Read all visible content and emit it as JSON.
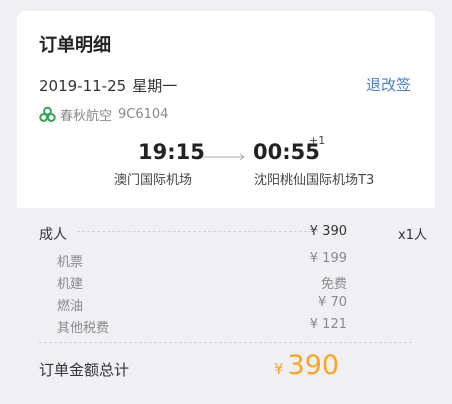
{
  "order": {
    "title": "订单明细",
    "date": "2019-11-25",
    "weekday": "星期一",
    "change_label": "退改签"
  },
  "airline": {
    "name": "春秋航空",
    "flight_no": "9C6104",
    "logo_icon": "spring-airlines-logo-icon",
    "logo_color": "#3aa35a"
  },
  "route": {
    "departure_time": "19:15",
    "departure_airport": "澳门国际机场",
    "arrival_time": "00:55",
    "day_offset": "+1",
    "arrival_airport": "沈阳桃仙国际机场T3",
    "arrow_icon": "arrow-right-icon"
  },
  "price": {
    "adult": {
      "label": "成人",
      "amount": "¥ 390",
      "qty": "x1人"
    },
    "items": [
      {
        "label": "机票",
        "amount": "¥ 199"
      },
      {
        "label": "机建",
        "amount": "免费"
      },
      {
        "label": "燃油",
        "amount": "¥ 70"
      },
      {
        "label": "其他税费",
        "amount": "¥ 121"
      }
    ],
    "total": {
      "label": "订单金额总计",
      "currency": "¥",
      "value": "390"
    }
  },
  "colors": {
    "accent": "#f5a623",
    "link": "#4a7fc4",
    "panel_bg": "#efeff4"
  }
}
